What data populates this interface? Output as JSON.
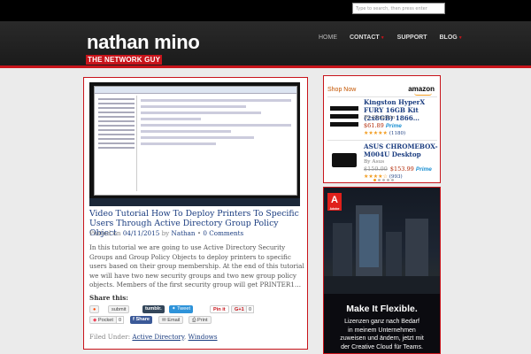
{
  "search": {
    "placeholder": "Type to search, then press enter"
  },
  "site": {
    "title": "nathan mino",
    "tagline": "THE NETWORK GUY"
  },
  "nav": {
    "items": [
      "HOME",
      "CONTACT",
      "SUPPORT",
      "BLOG"
    ]
  },
  "post": {
    "title": "Video Tutorial How To Deploy Printers To Specific Users Through Active Directory Group Policy Object",
    "posted_prefix": "Posted on",
    "date": "04/11/2015",
    "by": "by",
    "author": "Nathan",
    "bullet": "•",
    "comments": "0 Comments",
    "excerpt": "In this tutorial we are going to use Active Directory Security Groups and Group Policy Objects to deploy printers to specific users based on their group membership. At the end of this tutorial we will have two new security groups and two new group policy objects. Members of the first security group will get PRINTER1…",
    "share_label": "Share this:",
    "buttons": {
      "submit": "submit",
      "tumblr": "tumblr.",
      "tweet": "Tweet",
      "pin": "Pin it",
      "gplus": "G+1",
      "gplus_count": "0",
      "pocket": "Pocket",
      "pocket_count": "0",
      "share": "Share",
      "email": "Email",
      "print": "Print"
    },
    "filed_label": "Filed Under:",
    "categories": [
      "Active Directory",
      "Windows"
    ],
    "category_sep": ","
  },
  "shop": {
    "heading": "Shop Now",
    "brand": "amazon",
    "products": [
      {
        "title": "Kingston HyperX FURY 16GB Kit (2x8GB) 1866…",
        "by": "By Kingston",
        "price": "$61.89",
        "old_price": "",
        "prime": "Prime",
        "reviews": "(1180)",
        "stars": "★★★★★"
      },
      {
        "title": "ASUS CHROMEBOX-M004U Desktop",
        "by": "By Asus",
        "price": "$153.99",
        "old_price": "$159.99",
        "prime": "Prime",
        "reviews": "(993)",
        "stars": "★★★★☆"
      }
    ]
  },
  "ad": {
    "brand": "Adobe",
    "headline": "Make It Flexible.",
    "body": [
      "Lizenzen ganz nach Bedarf",
      "in meinem Unternehmen",
      "zuweisen und ändern, jetzt mit",
      "der Creative Cloud für Teams."
    ]
  },
  "colors": {
    "accent": "#c8141b",
    "link": "#1b3d80",
    "header": "#1b1b1b"
  }
}
